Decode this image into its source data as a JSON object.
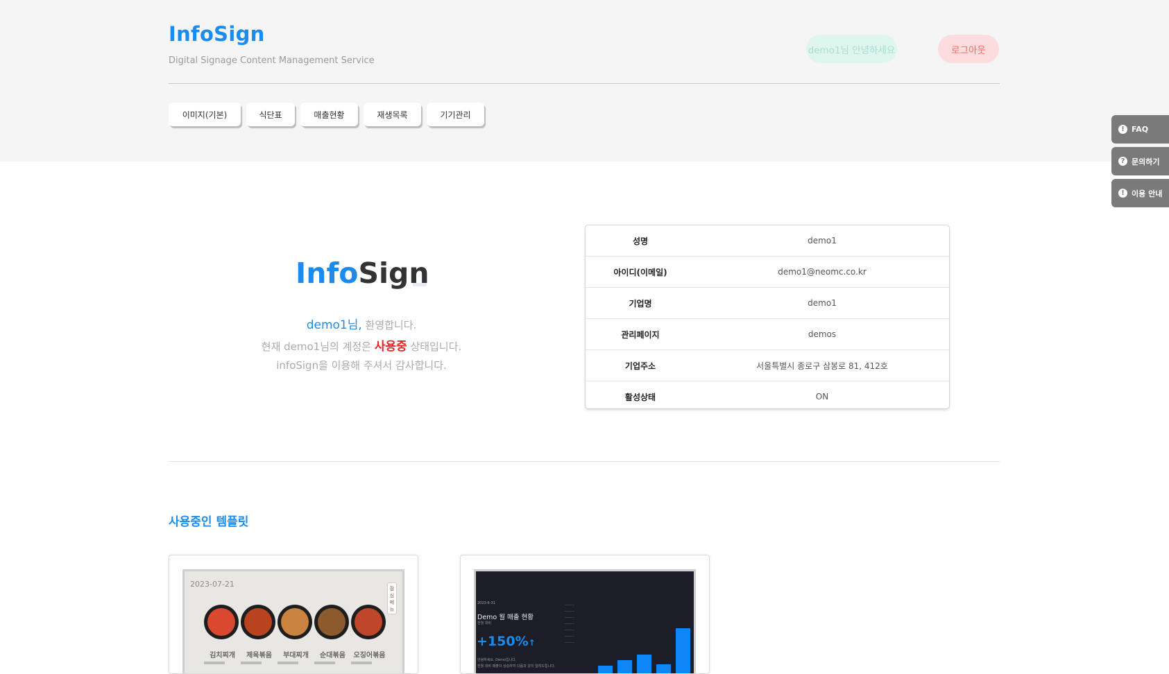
{
  "header": {
    "logo": "InfoSign",
    "tagline": "Digital Signage Content Management Service",
    "greeting": "demo1님 안녕하세요",
    "logout": "로그아웃"
  },
  "nav": {
    "items": [
      {
        "label": "이미지(기본)"
      },
      {
        "label": "식단표"
      },
      {
        "label": "매출현황"
      },
      {
        "label": "재생목록"
      },
      {
        "label": "기기관리"
      }
    ]
  },
  "side_tabs": [
    {
      "icon": "!",
      "label": "FAQ"
    },
    {
      "icon": "?",
      "label": "문의하기"
    },
    {
      "icon": "!",
      "label": "이용 안내"
    }
  ],
  "hero": {
    "logo_part1": "Info",
    "logo_part2": "Sign",
    "welcome_name": "demo1님,",
    "welcome_text": " 환영합니다.",
    "status_prefix": "현재 demo1님의 계정은 ",
    "status_value": "사용중",
    "status_suffix": " 상태입니다.",
    "thanks": "infoSign을 이용해 주셔서 감사합니다."
  },
  "account": {
    "rows": [
      {
        "label": "성명",
        "value": "demo1"
      },
      {
        "label": "아이디(이메일)",
        "value": "demo1@neomc.co.kr"
      },
      {
        "label": "기업명",
        "value": "demo1"
      },
      {
        "label": "관리페이지",
        "value": "demos"
      },
      {
        "label": "기업주소",
        "value": "서울특별시 종로구 삼봉로 81, 412호"
      },
      {
        "label": "활성상태",
        "value": "ON"
      }
    ]
  },
  "templates": {
    "title": "사용중인 템플릿",
    "menu_card": {
      "date": "2023-07-21",
      "tag": "점심메뉴",
      "dishes": [
        "김치찌개",
        "제육볶음",
        "부대찌개",
        "순대볶음",
        "오징어볶음"
      ],
      "dish_colors": [
        "#d9482f",
        "#b9431f",
        "#c8833f",
        "#8c5a2c",
        "#c0462b"
      ]
    },
    "sales_card": {
      "date": "2023-6-31",
      "title": "Demo 월 매출 현황",
      "subtitle": "전월 대비",
      "change": "+150%",
      "arrow": "↑",
      "note1": "안녕하세요. Demo입니다.",
      "note2": "전월 대비 매출이 상승하여 다음과 같이 알려드립니다.",
      "bars": [
        18,
        34,
        42,
        50,
        36,
        88
      ],
      "bar_color": "#0e86f5"
    }
  }
}
